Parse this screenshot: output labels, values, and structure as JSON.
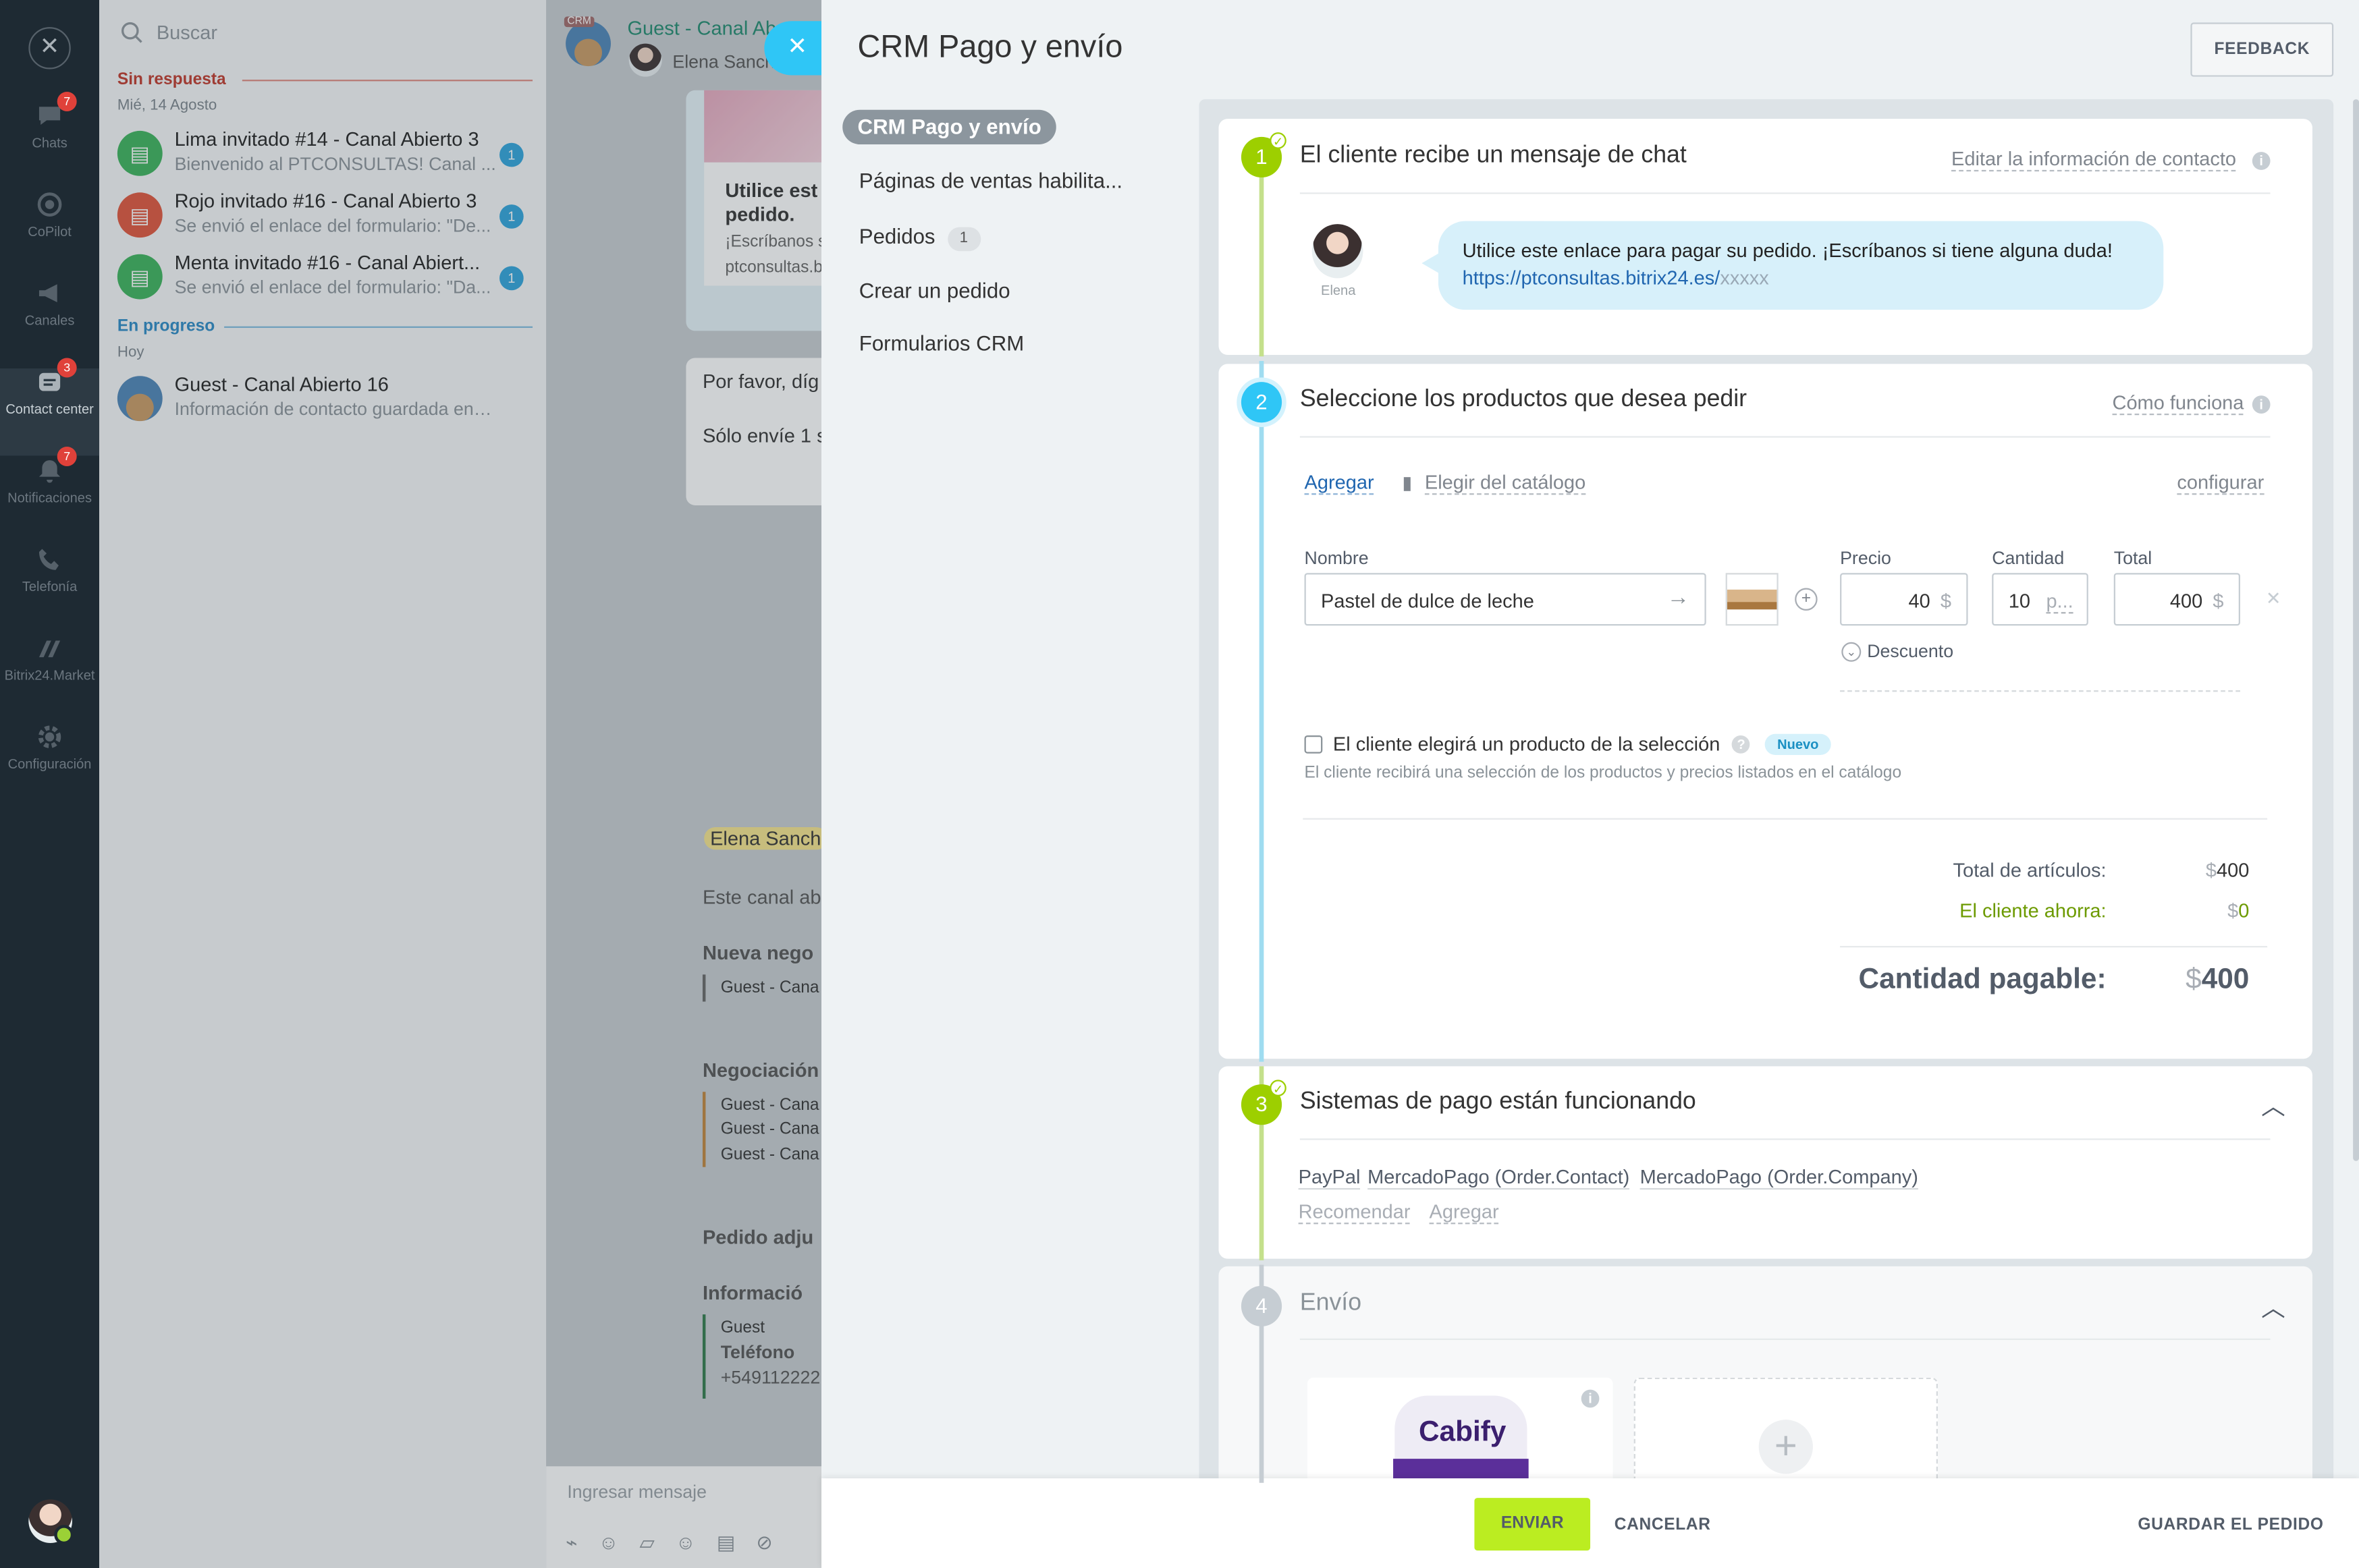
{
  "leftbar": {
    "items": [
      {
        "label": "Chats",
        "badge": "7",
        "icon": "chat-icon"
      },
      {
        "label": "CoPilot",
        "badge": "",
        "icon": "copilot-icon"
      },
      {
        "label": "Canales",
        "badge": "",
        "icon": "megaphone-icon"
      },
      {
        "label": "Contact center",
        "badge": "3",
        "icon": "contact-center-icon"
      },
      {
        "label": "Notificaciones",
        "badge": "7",
        "icon": "bell-icon"
      },
      {
        "label": "Telefonía",
        "badge": "",
        "icon": "phone-icon"
      },
      {
        "label": "Bitrix24.Market",
        "badge": "",
        "icon": "market-icon"
      },
      {
        "label": "Configuración",
        "badge": "",
        "icon": "gear-icon"
      }
    ]
  },
  "chatlist": {
    "search_placeholder": "Buscar",
    "section_unanswered": "Sin respuesta",
    "date_unanswered": "Mié, 14 Agosto",
    "section_progress": "En progreso",
    "date_progress": "Hoy",
    "items": [
      {
        "title": "Lima invitado #14 - Canal Abierto 3",
        "subtitle": "Bienvenido al PTCONSULTAS! Canal ...",
        "count": "1",
        "color": "#3bb35b"
      },
      {
        "title": "Rojo invitado #16 - Canal Abierto 3",
        "subtitle": "Se envió el enlace del formulario: \"De...",
        "count": "1",
        "color": "#e0553b"
      },
      {
        "title": "Menta invitado #16 - Canal Abiert...",
        "subtitle": "Se envió el enlace del formulario: \"Da...",
        "count": "1",
        "color": "#3bb35b"
      },
      {
        "title": "Guest - Canal Abierto 16",
        "subtitle": "Información de contacto guardada en el c...",
        "count": "",
        "color": "#6a8fb0"
      }
    ]
  },
  "chatpanel": {
    "header_title": "Guest - Canal Ab",
    "header_sub": "Elena Sanch",
    "crm_tag": "CRM",
    "card_title": "Utilice este pedido.",
    "card_title_1": "Utilice est",
    "card_title_2": "pedido.",
    "card_sub_1": "¡Escríbanos s",
    "card_sub_2": "ptconsultas.b",
    "msg_1": "Por favor, díg",
    "msg_2": "Sólo envíe 1 s",
    "name_tag": "Elena Sanch",
    "text_1": "Este canal ab",
    "h_nueva": "Nueva nego",
    "nueva_item": "Guest - Cana",
    "h_negociacion": "Negociación",
    "neg_items": [
      "Guest - Cana",
      "Guest - Cana",
      "Guest - Cana"
    ],
    "h_pedido": "Pedido adju",
    "h_info": "Informació",
    "info_guest": "Guest",
    "info_tel_label": "Teléfono",
    "info_tel": "+549112222",
    "input_placeholder": "Ingresar mensaje"
  },
  "slider": {
    "title": "CRM Pago y envío",
    "feedback": "FEEDBACK",
    "menu": {
      "active": "CRM Pago y envío",
      "pages": "Páginas de ventas habilita...",
      "orders": "Pedidos",
      "orders_count": "1",
      "create": "Crear un pedido",
      "forms": "Formularios CRM"
    }
  },
  "step1": {
    "num": "1",
    "title": "El cliente recibe un mensaje de chat",
    "link": "Editar la información de contacto",
    "avatar_name": "Elena",
    "message": "Utilice este enlace para pagar su pedido. ¡Escríbanos si tiene alguna duda!",
    "url": "https://ptconsultas.bitrix24.es/",
    "url_suffix": "xxxxx"
  },
  "step2": {
    "num": "2",
    "title": "Seleccione los productos que desea pedir",
    "how_link": "Cómo funciona",
    "add": "Agregar",
    "catalog": "Elegir del catálogo",
    "configure": "configurar",
    "label_name": "Nombre",
    "label_price": "Precio",
    "label_qty": "Cantidad",
    "label_total": "Total",
    "product_name": "Pastel de dulce de leche",
    "price": "40",
    "price_currency": "$",
    "qty": "10",
    "qty_unit": "p...",
    "total": "400",
    "total_currency": "$",
    "discount": "Descuento",
    "checkbox_label": "El cliente elegirá un producto de la selección",
    "badge_new": "Nuevo",
    "checkbox_hint": "El cliente recibirá una selección de los productos y precios listados en el catálogo",
    "items_total_label": "Total de artículos:",
    "items_total_currency": "$",
    "items_total": "400",
    "saves_label": "El cliente ahorra:",
    "saves_currency": "$",
    "saves": "0",
    "payable_label": "Cantidad pagable:",
    "payable_currency": "$",
    "payable": "400"
  },
  "step3": {
    "num": "3",
    "title": "Sistemas de pago están funcionando",
    "systems": [
      "PayPal",
      "MercadoPago (Order.Contact)",
      "MercadoPago (Order.Company)"
    ],
    "recommend": "Recomendar",
    "add": "Agregar"
  },
  "step4": {
    "num": "4",
    "title": "Envío",
    "card_logo": "Cabify"
  },
  "footer": {
    "send": "ENVIAR",
    "cancel": "CANCELAR",
    "save": "GUARDAR EL PEDIDO"
  }
}
